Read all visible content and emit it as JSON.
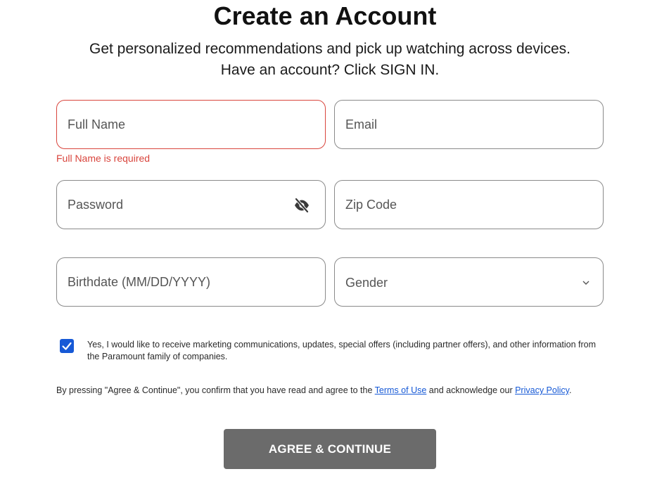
{
  "header": {
    "title": "Create an Account",
    "subtitle": "Get personalized recommendations and pick up watching across devices. Have an account? Click SIGN IN."
  },
  "form": {
    "full_name": {
      "placeholder": "Full Name",
      "value": "",
      "error": "Full Name is required"
    },
    "email": {
      "placeholder": "Email",
      "value": ""
    },
    "password": {
      "placeholder": "Password",
      "value": ""
    },
    "zip_code": {
      "placeholder": "Zip Code",
      "value": ""
    },
    "birthdate": {
      "placeholder": "Birthdate (MM/DD/YYYY)",
      "value": ""
    },
    "gender": {
      "selected": "Gender"
    }
  },
  "consent": {
    "checked": true,
    "text": "Yes, I would like to receive marketing communications, updates, special offers (including partner offers), and other information from the Paramount family of companies."
  },
  "legal": {
    "prefix": "By pressing \"Agree & Continue\", you confirm that you have read and agree to the ",
    "terms_link": "Terms of Use",
    "middle": " and acknowledge our ",
    "privacy_link": "Privacy Policy",
    "suffix": "."
  },
  "actions": {
    "agree_label": "AGREE & CONTINUE"
  },
  "colors": {
    "error": "#d9453d",
    "link": "#1659d6",
    "checkbox": "#1659d6",
    "button_bg": "#6b6b6b"
  },
  "icons": {
    "password_toggle": "eye-slash-icon",
    "gender_dropdown": "chevron-down-icon",
    "checkbox_mark": "checkmark-icon"
  }
}
